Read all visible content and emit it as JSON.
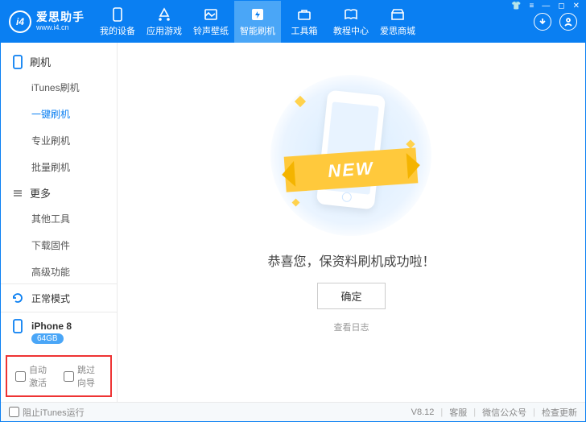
{
  "brand": {
    "name": "爱思助手",
    "subtitle": "www.i4.cn",
    "logo_text": "i4"
  },
  "nav": {
    "items": [
      {
        "label": "我的设备"
      },
      {
        "label": "应用游戏"
      },
      {
        "label": "铃声壁纸"
      },
      {
        "label": "智能刷机"
      },
      {
        "label": "工具箱"
      },
      {
        "label": "教程中心"
      },
      {
        "label": "爱思商城"
      }
    ],
    "active_index": 3
  },
  "sidebar": {
    "sections": [
      {
        "title": "刷机",
        "items": [
          "iTunes刷机",
          "一键刷机",
          "专业刷机",
          "批量刷机"
        ],
        "active_index": 1
      },
      {
        "title": "更多",
        "items": [
          "其他工具",
          "下载固件",
          "高级功能"
        ],
        "active_index": -1
      }
    ],
    "mode": "正常模式",
    "device": {
      "name": "iPhone 8",
      "storage": "64GB"
    },
    "auto_activate": "自动激活",
    "skip_guide": "跳过向导"
  },
  "main": {
    "ribbon": "NEW",
    "message": "恭喜您，保资料刷机成功啦！",
    "ok": "确定",
    "view_log": "查看日志"
  },
  "footer": {
    "block_itunes": "阻止iTunes运行",
    "version": "V8.12",
    "links": [
      "客服",
      "微信公众号",
      "检查更新"
    ]
  }
}
